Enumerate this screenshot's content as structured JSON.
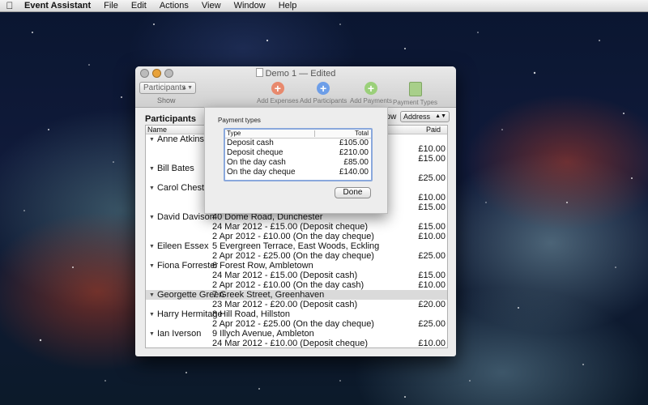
{
  "menubar": {
    "app_name": "Event Assistant",
    "items": [
      "File",
      "Edit",
      "Actions",
      "View",
      "Window",
      "Help"
    ]
  },
  "window": {
    "title": "Demo 1",
    "title_suffix": "— Edited",
    "show_popup": "Participants",
    "show_label": "Show",
    "toolbar": [
      {
        "label": "Add Expenses",
        "icon": "plus-icon",
        "color": "#e8896d"
      },
      {
        "label": "Add Participants",
        "icon": "plus-icon",
        "color": "#6d9ee8"
      },
      {
        "label": "Add Payments",
        "icon": "plus-icon",
        "color": "#9bd07a"
      },
      {
        "label": "Payment Types",
        "icon": "payment-types-icon",
        "color": "#a8cf8a"
      }
    ]
  },
  "participants": {
    "title": "Participants",
    "show_text": "how",
    "show_select": "Address",
    "col_name": "Name",
    "col_paid": "Paid",
    "rows": [
      {
        "name": "Anne Atkins",
        "detail": "",
        "paid": ""
      },
      {
        "name": "",
        "detail": "",
        "paid": "£10.00"
      },
      {
        "name": "",
        "detail": "",
        "paid": "£15.00"
      },
      {
        "name": "Bill Bates",
        "detail": "",
        "paid": ""
      },
      {
        "name": "",
        "detail": "",
        "paid": "£25.00"
      },
      {
        "name": "Carol Chester",
        "detail": "",
        "paid": ""
      },
      {
        "name": "",
        "detail": "",
        "paid": "£10.00"
      },
      {
        "name": "",
        "detail": "",
        "paid": "£15.00"
      },
      {
        "name": "David Davison",
        "detail": "40 Dome Road, Dunchester",
        "paid": ""
      },
      {
        "name": "",
        "detail": "24 Mar 2012 - £15.00 (Deposit cheque)",
        "paid": "£15.00"
      },
      {
        "name": "",
        "detail": "2 Apr 2012 - £10.00 (On the day cheque)",
        "paid": "£10.00"
      },
      {
        "name": "Eileen Essex",
        "detail": "5 Evergreen Terrace, East Woods, Eckling",
        "paid": ""
      },
      {
        "name": "",
        "detail": "2 Apr 2012 - £25.00 (On the day cheque)",
        "paid": "£25.00"
      },
      {
        "name": "Fiona Forrester",
        "detail": "6 Forest Row, Ambletown",
        "paid": ""
      },
      {
        "name": "",
        "detail": "24 Mar 2012 - £15.00 (Deposit cash)",
        "paid": "£15.00"
      },
      {
        "name": "",
        "detail": "2 Apr 2012 - £10.00 (On the day cash)",
        "paid": "£10.00"
      },
      {
        "name": "Georgette Green",
        "detail": "7 Greek Street, Greenhaven",
        "paid": "",
        "selected": true
      },
      {
        "name": "",
        "detail": "23 Mar 2012 - £20.00 (Deposit cash)",
        "paid": "£20.00"
      },
      {
        "name": "Harry Hermitage",
        "detail": "8 Hill Road, Hillston",
        "paid": ""
      },
      {
        "name": "",
        "detail": "2 Apr 2012 - £25.00 (On the day cheque)",
        "paid": "£25.00"
      },
      {
        "name": "Ian Iverson",
        "detail": "9 Illych Avenue, Ambleton",
        "paid": ""
      },
      {
        "name": "",
        "detail": "24 Mar 2012 - £10.00 (Deposit cheque)",
        "paid": "£10.00"
      }
    ]
  },
  "sheet": {
    "title": "Payment types",
    "col_type": "Type",
    "col_total": "Total",
    "rows": [
      {
        "type": "Deposit cash",
        "total": "£105.00"
      },
      {
        "type": "Deposit cheque",
        "total": "£210.00"
      },
      {
        "type": "On the day cash",
        "total": "£85.00"
      },
      {
        "type": "On the day cheque",
        "total": "£140.00"
      }
    ],
    "done_label": "Done"
  }
}
